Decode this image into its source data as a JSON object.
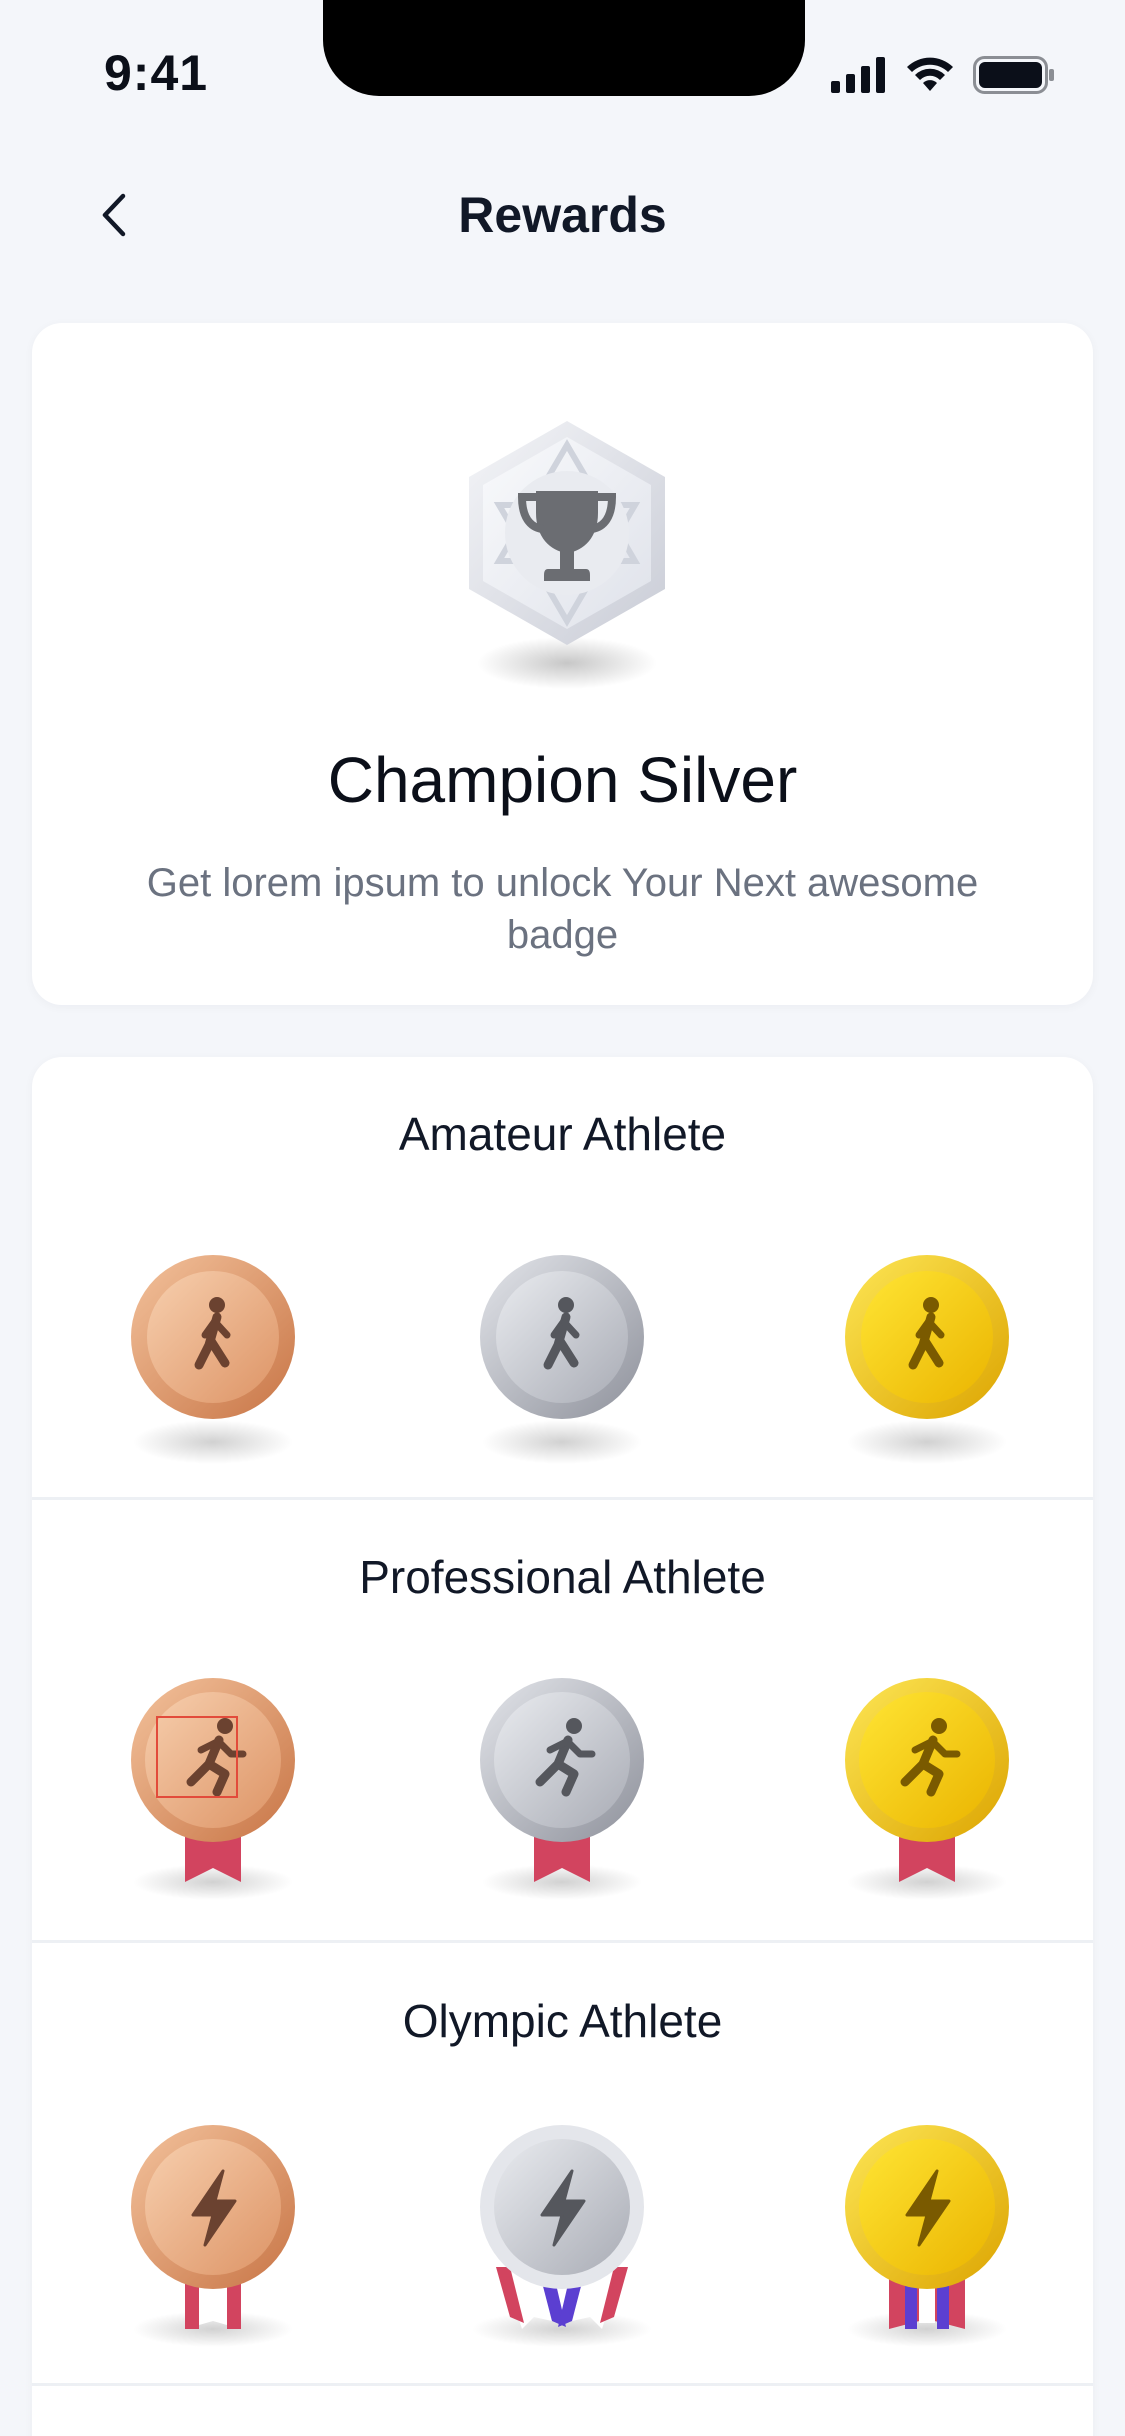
{
  "status": {
    "time": "9:41"
  },
  "nav": {
    "title": "Rewards",
    "back_icon": "chevron-left-icon"
  },
  "hero": {
    "badge_icon": "trophy-icon",
    "title": "Champion Silver",
    "subtitle": "Get lorem ipsum to unlock Your Next awesome badge"
  },
  "levels": [
    {
      "title": "Amateur Athlete",
      "icon": "walking-person-icon",
      "tiers": [
        "bronze",
        "silver",
        "gold"
      ]
    },
    {
      "title": "Professional Athlete",
      "icon": "running-person-icon",
      "tiers": [
        "bronze",
        "silver",
        "gold"
      ]
    },
    {
      "title": "Olympic Athlete",
      "icon": "lightning-bolt-icon",
      "tiers": [
        "bronze",
        "silver",
        "gold"
      ]
    }
  ],
  "colors": {
    "background": "#f4f6fa",
    "bronze": "#d98d5d",
    "silver": "#b9bcc7",
    "gold": "#f2c511",
    "ribbon_red": "#d2445f",
    "ribbon_purple": "#5b3fd1"
  }
}
